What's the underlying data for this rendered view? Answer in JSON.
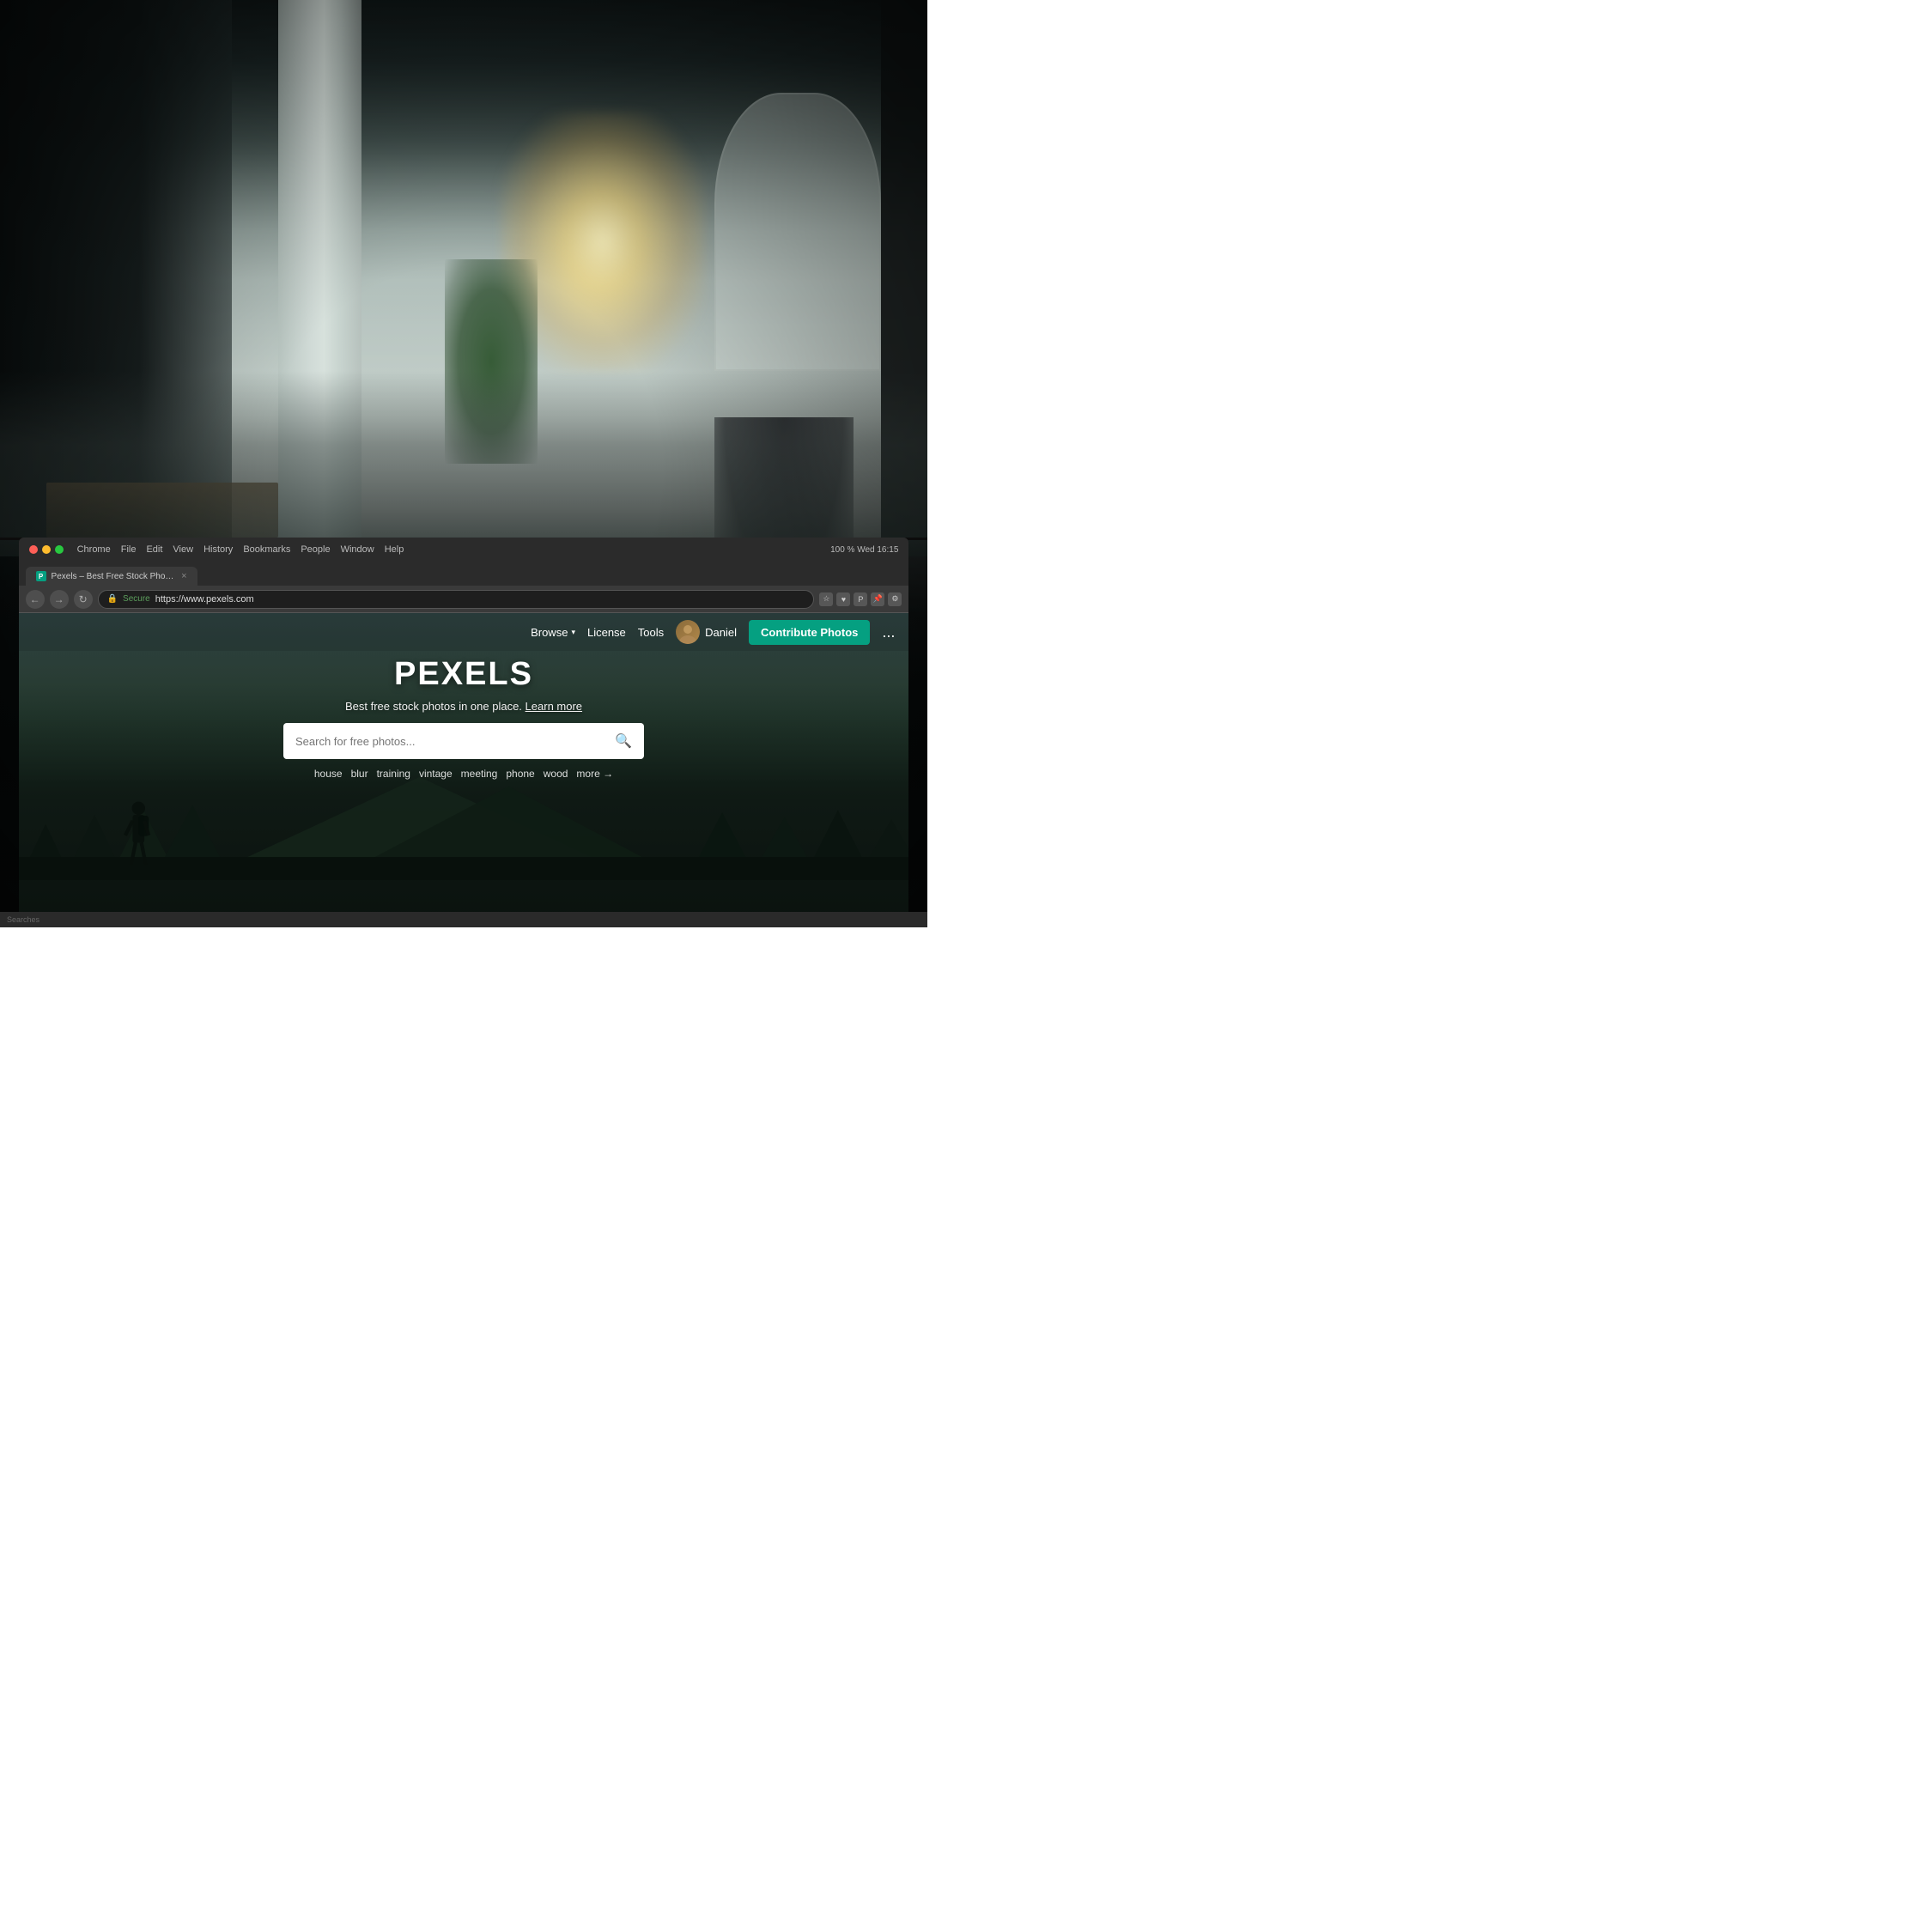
{
  "background": {
    "alt": "Office interior with large windows, plants, and natural light"
  },
  "browser": {
    "title": "Pexels – Best Free Stock Photos",
    "tab_label": "Pexels – Best Free Stock Photos",
    "url_secure": "Secure",
    "url": "https://www.pexels.com",
    "nav_back": "←",
    "nav_forward": "→",
    "nav_refresh": "↻",
    "menu_items": [
      "Chrome",
      "File",
      "Edit",
      "View",
      "History",
      "Bookmarks",
      "People",
      "Window",
      "Help"
    ],
    "system_status": "100 %  Wed 16:15",
    "tab_favicon_text": "P",
    "tab_close": "×"
  },
  "pexels": {
    "logo": "PEXELS",
    "tagline": "Best free stock photos in one place.",
    "learn_more": "Learn more",
    "search_placeholder": "Search for free photos...",
    "nav": {
      "browse": "Browse",
      "license": "License",
      "tools": "Tools",
      "user_name": "Daniel",
      "contribute_btn": "Contribute Photos",
      "more_btn": "..."
    },
    "suggestions": [
      "house",
      "blur",
      "training",
      "vintage",
      "meeting",
      "phone",
      "wood",
      "more →"
    ]
  },
  "statusbar": {
    "text": "Searches"
  }
}
